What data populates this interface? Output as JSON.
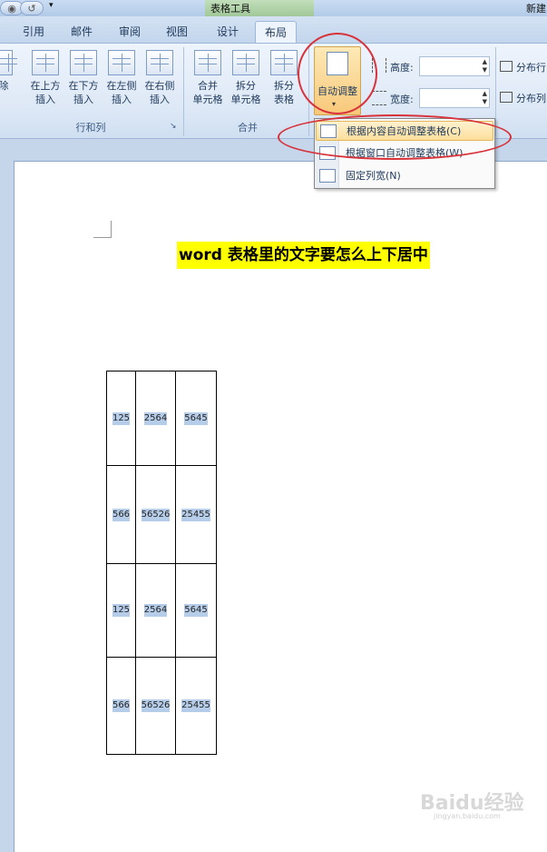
{
  "window": {
    "title": "表格工具",
    "doc_title": "新建",
    "quick_access": [
      "◉",
      "↺"
    ]
  },
  "tabs": [
    {
      "id": "refs",
      "label": "引用"
    },
    {
      "id": "mail",
      "label": "邮件"
    },
    {
      "id": "review",
      "label": "审阅"
    },
    {
      "id": "view",
      "label": "视图"
    },
    {
      "id": "design",
      "label": "设计"
    },
    {
      "id": "layout",
      "label": "布局",
      "active": true
    }
  ],
  "ribbon": {
    "rows_cols": {
      "delete_label": "除",
      "insert_above": [
        "在上方",
        "插入"
      ],
      "insert_below": [
        "在下方",
        "插入"
      ],
      "insert_left": [
        "在左侧",
        "插入"
      ],
      "insert_right": [
        "在右侧",
        "插入"
      ],
      "group_label": "行和列"
    },
    "merge": {
      "merge_cells": [
        "合并",
        "单元格"
      ],
      "split_cells": [
        "拆分",
        "单元格"
      ],
      "split_table": [
        "拆分",
        "表格"
      ],
      "group_label": "合并"
    },
    "autofit": {
      "label": "自动调整",
      "caret": "▾"
    },
    "cell_size": {
      "height_label": "高度:",
      "width_label": "宽度:",
      "height_value": "",
      "width_value": "",
      "distribute_rows": "分布行",
      "distribute_cols": "分布列"
    },
    "dialog_launcher": "↘"
  },
  "autofit_menu": [
    {
      "label": "根据内容自动调整表格(C)",
      "highlighted": true
    },
    {
      "label": "根据窗口自动调整表格(W)",
      "highlighted": false
    },
    {
      "label": "固定列宽(N)",
      "highlighted": false
    }
  ],
  "document": {
    "heading": "word 表格里的文字要怎么上下居中",
    "table": [
      [
        "125",
        "2564",
        "5645"
      ],
      [
        "566",
        "56526",
        "25455"
      ],
      [
        "125",
        "2564",
        "5645"
      ],
      [
        "566",
        "56526",
        "25455"
      ]
    ]
  },
  "watermark": {
    "brand": "Baidu经验",
    "url": "jingyan.baidu.com"
  },
  "colors": {
    "annotation_red": "#d8323a",
    "heading_highlight": "#ffff00",
    "menu_highlight": "#fddf9c",
    "cell_text_highlight": "#b6cde9"
  }
}
